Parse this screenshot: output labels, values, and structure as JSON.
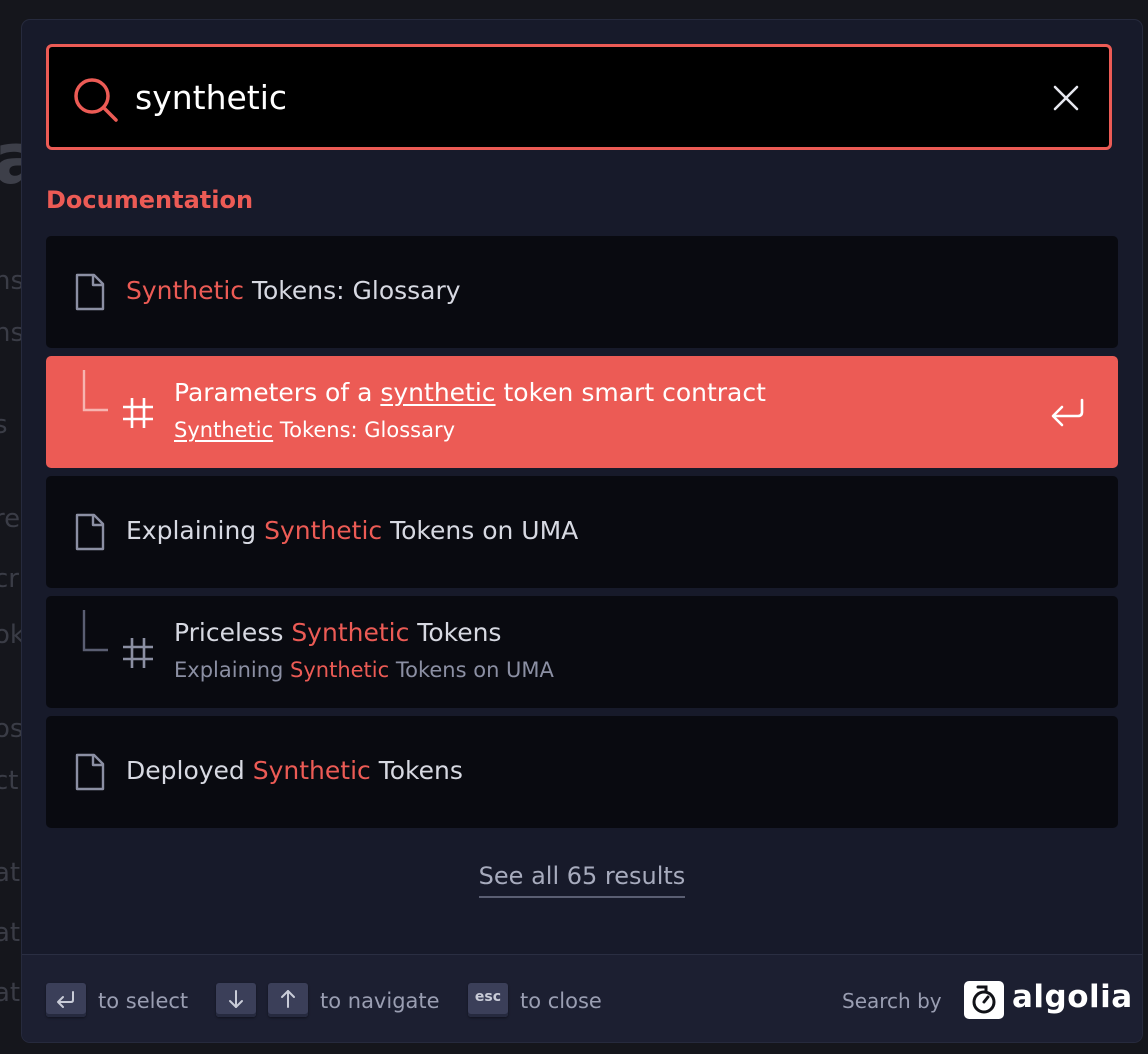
{
  "background": {
    "fragments": [
      "a",
      "ns",
      "ns",
      "s",
      "re",
      "cr",
      "ok",
      "os",
      "ct",
      "at",
      "at",
      "at"
    ]
  },
  "search": {
    "query": "synthetic",
    "placeholder": "",
    "accent_color": "#ec5b55"
  },
  "section": {
    "title": "Documentation"
  },
  "hits": [
    {
      "type": "page",
      "title_mark": "Synthetic",
      "title_rest": " Tokens: Glossary",
      "icon": "document-icon"
    },
    {
      "type": "section",
      "active": true,
      "title_pre": "Parameters of a ",
      "title_mark": "synthetic",
      "title_post": " token smart contract",
      "path_mark": "Synthetic",
      "path_rest": " Tokens: Glossary",
      "icon": "hash-icon"
    },
    {
      "type": "page",
      "title_pre": "Explaining ",
      "title_mark": "Synthetic",
      "title_post": " Tokens on UMA",
      "icon": "document-icon"
    },
    {
      "type": "section",
      "title_pre": "Priceless ",
      "title_mark": "Synthetic",
      "title_post": " Tokens",
      "path_pre": "Explaining ",
      "path_mark": "Synthetic",
      "path_post": " Tokens on UMA",
      "icon": "hash-icon"
    },
    {
      "type": "page",
      "title_pre": "Deployed ",
      "title_mark": "Synthetic",
      "title_post": " Tokens",
      "icon": "document-icon"
    }
  ],
  "see_all": "See all 65 results",
  "footer": {
    "select_label": "to select",
    "navigate_label": "to navigate",
    "close_label": "to close",
    "esc_key": "esc",
    "search_by": "Search by",
    "brand": "algolia"
  }
}
